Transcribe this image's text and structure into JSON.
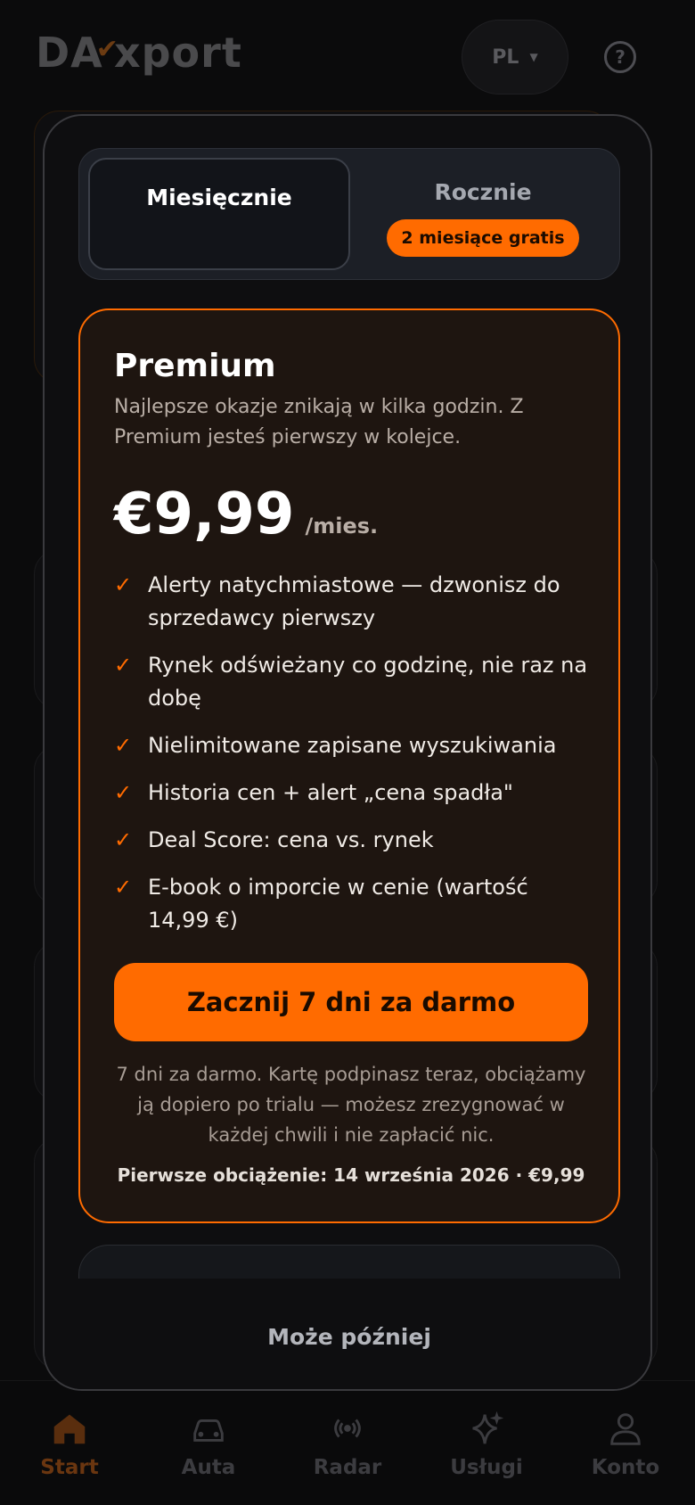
{
  "header": {
    "logo_text": "DAExport",
    "language": "PL"
  },
  "billing_toggle": {
    "monthly_label": "Miesięcznie",
    "yearly_label": "Rocznie",
    "yearly_badge": "2 miesiące gratis",
    "selected": "monthly"
  },
  "plan": {
    "name": "Premium",
    "description": "Najlepsze okazje znikają w kilka godzin. Z Premium jesteś pierwszy w kolejce.",
    "price": "€9,99",
    "period": "/mies.",
    "features": [
      "Alerty natychmiastowe — dzwonisz do sprzedawcy pierwszy",
      "Rynek odświeżany co godzinę, nie raz na dobę",
      "Nielimitowane zapisane wyszukiwania",
      "Historia cen + alert „cena spadła\"",
      "Deal Score: cena vs. rynek",
      "E-book o imporcie w cenie (wartość 14,99 €)"
    ],
    "cta_label": "Zacznij 7 dni za darmo",
    "trial_note": "7 dni za darmo. Kartę podpinasz teraz, obciążamy ją dopiero po trialu — możesz zrezygnować w każdej chwili i nie zapłacić nic.",
    "first_charge": "Pierwsze obciążenie: 14 września 2026 · €9,99"
  },
  "later_label": "Może później",
  "bottom_nav": [
    {
      "label": "Start",
      "icon": "home-icon",
      "active": true
    },
    {
      "label": "Auta",
      "icon": "car-icon",
      "active": false
    },
    {
      "label": "Radar",
      "icon": "radar-icon",
      "active": false
    },
    {
      "label": "Usługi",
      "icon": "sparkle-icon",
      "active": false
    },
    {
      "label": "Konto",
      "icon": "user-icon",
      "active": false
    }
  ],
  "colors": {
    "accent": "#ff6b00",
    "plan_bg": "#1e1510",
    "modal_bg": "#0e0e10"
  }
}
